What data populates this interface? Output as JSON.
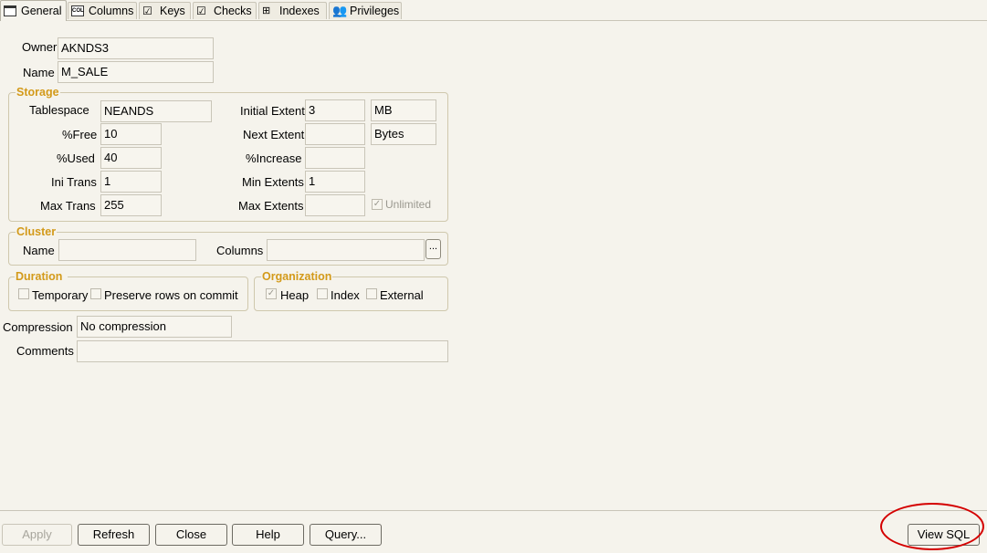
{
  "tabs": [
    {
      "label": "General",
      "icon": "general-icon"
    },
    {
      "label": "Columns",
      "icon": "columns-icon"
    },
    {
      "label": "Keys",
      "icon": "keys-icon"
    },
    {
      "label": "Checks",
      "icon": "checks-icon"
    },
    {
      "label": "Indexes",
      "icon": "indexes-icon"
    },
    {
      "label": "Privileges",
      "icon": "privileges-icon"
    }
  ],
  "general": {
    "owner_label": "Owner",
    "owner_value": "AKNDS3",
    "name_label": "Name",
    "name_value": "M_SALE"
  },
  "storage": {
    "title": "Storage",
    "tablespace_label": "Tablespace",
    "tablespace_value": "NEANDS",
    "free_label": "%Free",
    "free_value": "10",
    "used_label": "%Used",
    "used_value": "40",
    "ini_trans_label": "Ini Trans",
    "ini_trans_value": "1",
    "max_trans_label": "Max Trans",
    "max_trans_value": "255",
    "initial_extent_label": "Initial Extent",
    "initial_extent_value": "3",
    "initial_extent_unit": "MB",
    "next_extent_label": "Next Extent",
    "next_extent_value": "",
    "next_extent_unit": "Bytes",
    "increase_label": "%Increase",
    "increase_value": "",
    "min_extents_label": "Min Extents",
    "min_extents_value": "1",
    "max_extents_label": "Max Extents",
    "max_extents_value": "",
    "unlimited_label": "Unlimited",
    "unlimited_checked": true
  },
  "cluster": {
    "title": "Cluster",
    "name_label": "Name",
    "name_value": "",
    "columns_label": "Columns",
    "columns_value": "",
    "ellipsis": "..."
  },
  "duration": {
    "title": "Duration",
    "temporary_label": "Temporary",
    "preserve_label": "Preserve rows on commit"
  },
  "organization": {
    "title": "Organization",
    "heap_label": "Heap",
    "heap_checked": true,
    "index_label": "Index",
    "external_label": "External"
  },
  "compression": {
    "label": "Compression",
    "value": "No compression"
  },
  "comments": {
    "label": "Comments",
    "value": ""
  },
  "buttons": {
    "apply": "Apply",
    "refresh": "Refresh",
    "close": "Close",
    "help": "Help",
    "query": "Query...",
    "view_sql": "View SQL"
  },
  "colors": {
    "group_title": "#d39a1a",
    "annotation": "#d40000",
    "background": "#f5f3ec"
  }
}
